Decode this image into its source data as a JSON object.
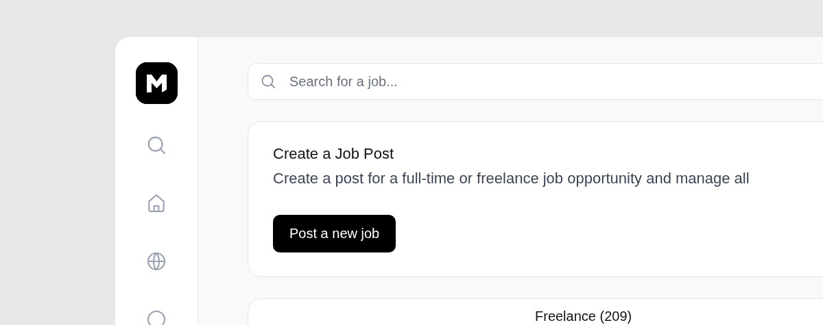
{
  "search": {
    "placeholder": "Search for a job..."
  },
  "create_card": {
    "title": "Create a Job Post",
    "description": "Create a post for a full-time or freelance job opportunity and manage all",
    "button": "Post a new job"
  },
  "tabs": [
    {
      "label": "Freelance (209)"
    }
  ]
}
